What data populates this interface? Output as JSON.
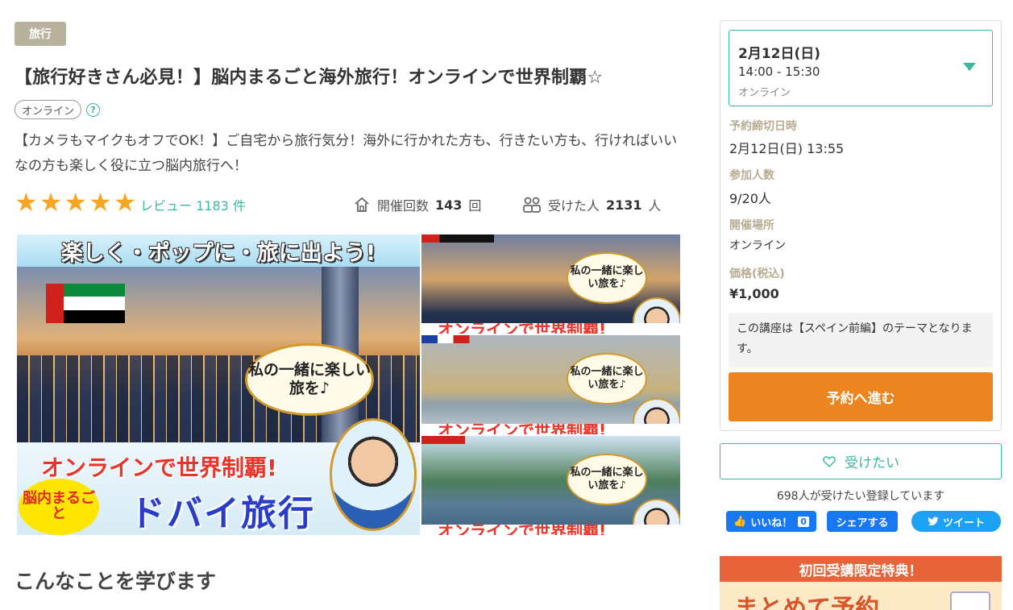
{
  "category": "旅行",
  "title": "【旅行好きさん必見！】脳内まるごと海外旅行！オンラインで世界制覇☆",
  "format_tag": "オンライン",
  "help_glyph": "?",
  "description": "【カメラもマイクもオフでOK！】ご自宅から旅行気分！海外に行かれた方も、行きたい方も、行ければいいなの方も楽しく役に立つ脳内旅行へ！",
  "rating": {
    "stars": 5,
    "max": 5,
    "review_label": "レビュー 1183 件"
  },
  "stats": {
    "held_label": "開催回数",
    "held_value": "143",
    "held_unit": "回",
    "joined_label": "受けた人",
    "joined_value": "2131",
    "joined_unit": "人"
  },
  "hero_image": {
    "banner": "楽しく・ポップに・旅に出よう!",
    "bubble": "私の一緒に楽しい旅を♪",
    "title_line1": "オンラインで世界制覇!",
    "badge": "脳内まるごと",
    "title_line2": "ドバイ旅行"
  },
  "thumbnails": [
    {
      "bubble": "私の一緒に楽しい旅を♪",
      "strip": "オンラインで世界制覇!"
    },
    {
      "bubble": "私の一緒に楽しい旅を♪",
      "strip": "オンラインで世界制覇!"
    },
    {
      "bubble": "私の一緒に楽しい旅を♪",
      "strip": "オンラインで世界制覇!"
    }
  ],
  "section_title": "こんなことを学びます",
  "booking": {
    "date": "2月12日(日)",
    "time": "14:00 - 15:30",
    "place": "オンライン",
    "deadline_label": "予約締切日時",
    "deadline_value": "2月12日(日) 13:55",
    "capacity_label": "参加人数",
    "capacity_value": "9/20人",
    "venue_label": "開催場所",
    "venue_value": "オンライン",
    "price_label": "価格(税込)",
    "price_value": "¥1,000",
    "note": "この講座は【スペイン前編】のテーマとなります。",
    "reserve_button": "予約へ進む"
  },
  "want": {
    "button": "受けたい",
    "count_text": "698人が受けたい登録しています"
  },
  "social": {
    "like_label": "いいね！",
    "like_count": "0",
    "share_label": "シェアする",
    "tweet_label": "ツイート"
  },
  "promo": {
    "header": "初回受講限定特典！",
    "text": "まとめて予約"
  },
  "colors": {
    "accent": "#3bb8a0",
    "reserve": "#ea8520",
    "star": "#f5a623",
    "facebook": "#1877f2",
    "twitter": "#1da1f2",
    "category_badge": "#b8b19c",
    "promo_header": "#e7643a"
  },
  "icons": {
    "held": "house-icon",
    "joined": "people-icon",
    "want": "heart-icon",
    "date_toggle": "caret-down-icon"
  }
}
